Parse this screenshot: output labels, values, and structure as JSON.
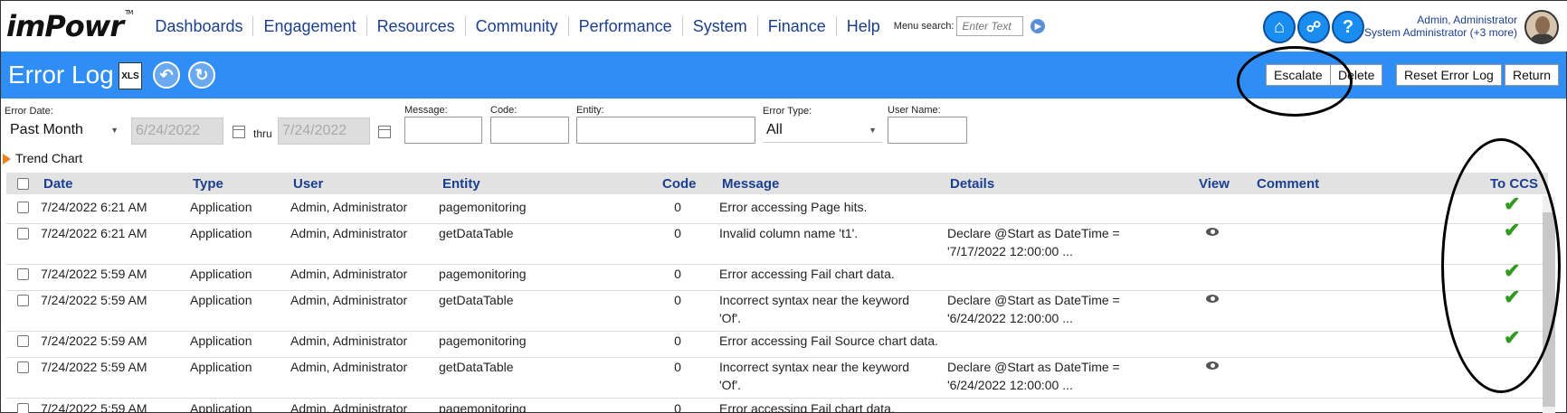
{
  "app": {
    "logo": "imPowr",
    "logo_mark": "TM"
  },
  "nav": {
    "items": [
      "Dashboards",
      "Engagement",
      "Resources",
      "Community",
      "Performance",
      "System",
      "Finance",
      "Help"
    ],
    "search_label": "Menu search:",
    "search_placeholder": "Enter Text"
  },
  "user": {
    "name": "Admin, Administrator",
    "role": "System Administrator (+3 more)",
    "icons": [
      "home-icon",
      "share-icon",
      "help-icon"
    ]
  },
  "page": {
    "title": "Error Log",
    "xls_label": "XLS",
    "buttons": {
      "escalate": "Escalate",
      "delete": "Delete",
      "reset": "Reset Error Log",
      "return": "Return"
    }
  },
  "filters": {
    "error_date_label": "Error Date:",
    "error_date_value": "Past Month",
    "from_date": "6/24/2022",
    "thru_label": "thru",
    "to_date": "7/24/2022",
    "message_label": "Message:",
    "code_label": "Code:",
    "entity_label": "Entity:",
    "error_type_label": "Error Type:",
    "error_type_value": "All",
    "user_name_label": "User Name:"
  },
  "trend_chart_label": "Trend Chart",
  "table": {
    "columns": {
      "date": "Date",
      "type": "Type",
      "user": "User",
      "entity": "Entity",
      "code": "Code",
      "message": "Message",
      "details": "Details",
      "view": "View",
      "comment": "Comment",
      "to_ccs": "To CCS"
    },
    "rows": [
      {
        "date": "7/24/2022 6:21 AM",
        "type": "Application",
        "user": "Admin, Administrator",
        "entity": "pagemonitoring",
        "code": "0",
        "message": "Error accessing Page hits.",
        "message2": "",
        "details": "",
        "details2": "",
        "view": false,
        "to_ccs": true
      },
      {
        "date": "7/24/2022 6:21 AM",
        "type": "Application",
        "user": "Admin, Administrator",
        "entity": "getDataTable",
        "code": "0",
        "message": "Invalid column name 't1'.",
        "message2": "",
        "details": "Declare @Start as DateTime =",
        "details2": "'7/17/2022 12:00:00 ...",
        "view": true,
        "to_ccs": true
      },
      {
        "date": "7/24/2022 5:59 AM",
        "type": "Application",
        "user": "Admin, Administrator",
        "entity": "pagemonitoring",
        "code": "0",
        "message": "Error accessing Fail chart data.",
        "message2": "",
        "details": "",
        "details2": "",
        "view": false,
        "to_ccs": true
      },
      {
        "date": "7/24/2022 5:59 AM",
        "type": "Application",
        "user": "Admin, Administrator",
        "entity": "getDataTable",
        "code": "0",
        "message": "Incorrect syntax near the keyword",
        "message2": "'Of'.",
        "details": "Declare @Start as DateTime =",
        "details2": "'6/24/2022 12:00:00 ...",
        "view": true,
        "to_ccs": true
      },
      {
        "date": "7/24/2022 5:59 AM",
        "type": "Application",
        "user": "Admin, Administrator",
        "entity": "pagemonitoring",
        "code": "0",
        "message": "Error accessing Fail Source chart data.",
        "message2": "",
        "details": "",
        "details2": "",
        "view": false,
        "to_ccs": true
      },
      {
        "date": "7/24/2022 5:59 AM",
        "type": "Application",
        "user": "Admin, Administrator",
        "entity": "getDataTable",
        "code": "0",
        "message": "Incorrect syntax near the keyword",
        "message2": "'Of'.",
        "details": "Declare @Start as DateTime =",
        "details2": "'6/24/2022 12:00:00 ...",
        "view": true,
        "to_ccs": false
      },
      {
        "date": "7/24/2022 5:59 AM",
        "type": "Application",
        "user": "Admin, Administrator",
        "entity": "pagemonitoring",
        "code": "0",
        "message": "Error accessing Fail chart data.",
        "message2": "",
        "details": "",
        "details2": "",
        "view": false,
        "to_ccs": false
      }
    ]
  },
  "colors": {
    "title_bar": "#2e8ef6",
    "nav_link": "#1b3f8f",
    "check": "#2f9a1e",
    "trend_marker": "#f08020"
  }
}
